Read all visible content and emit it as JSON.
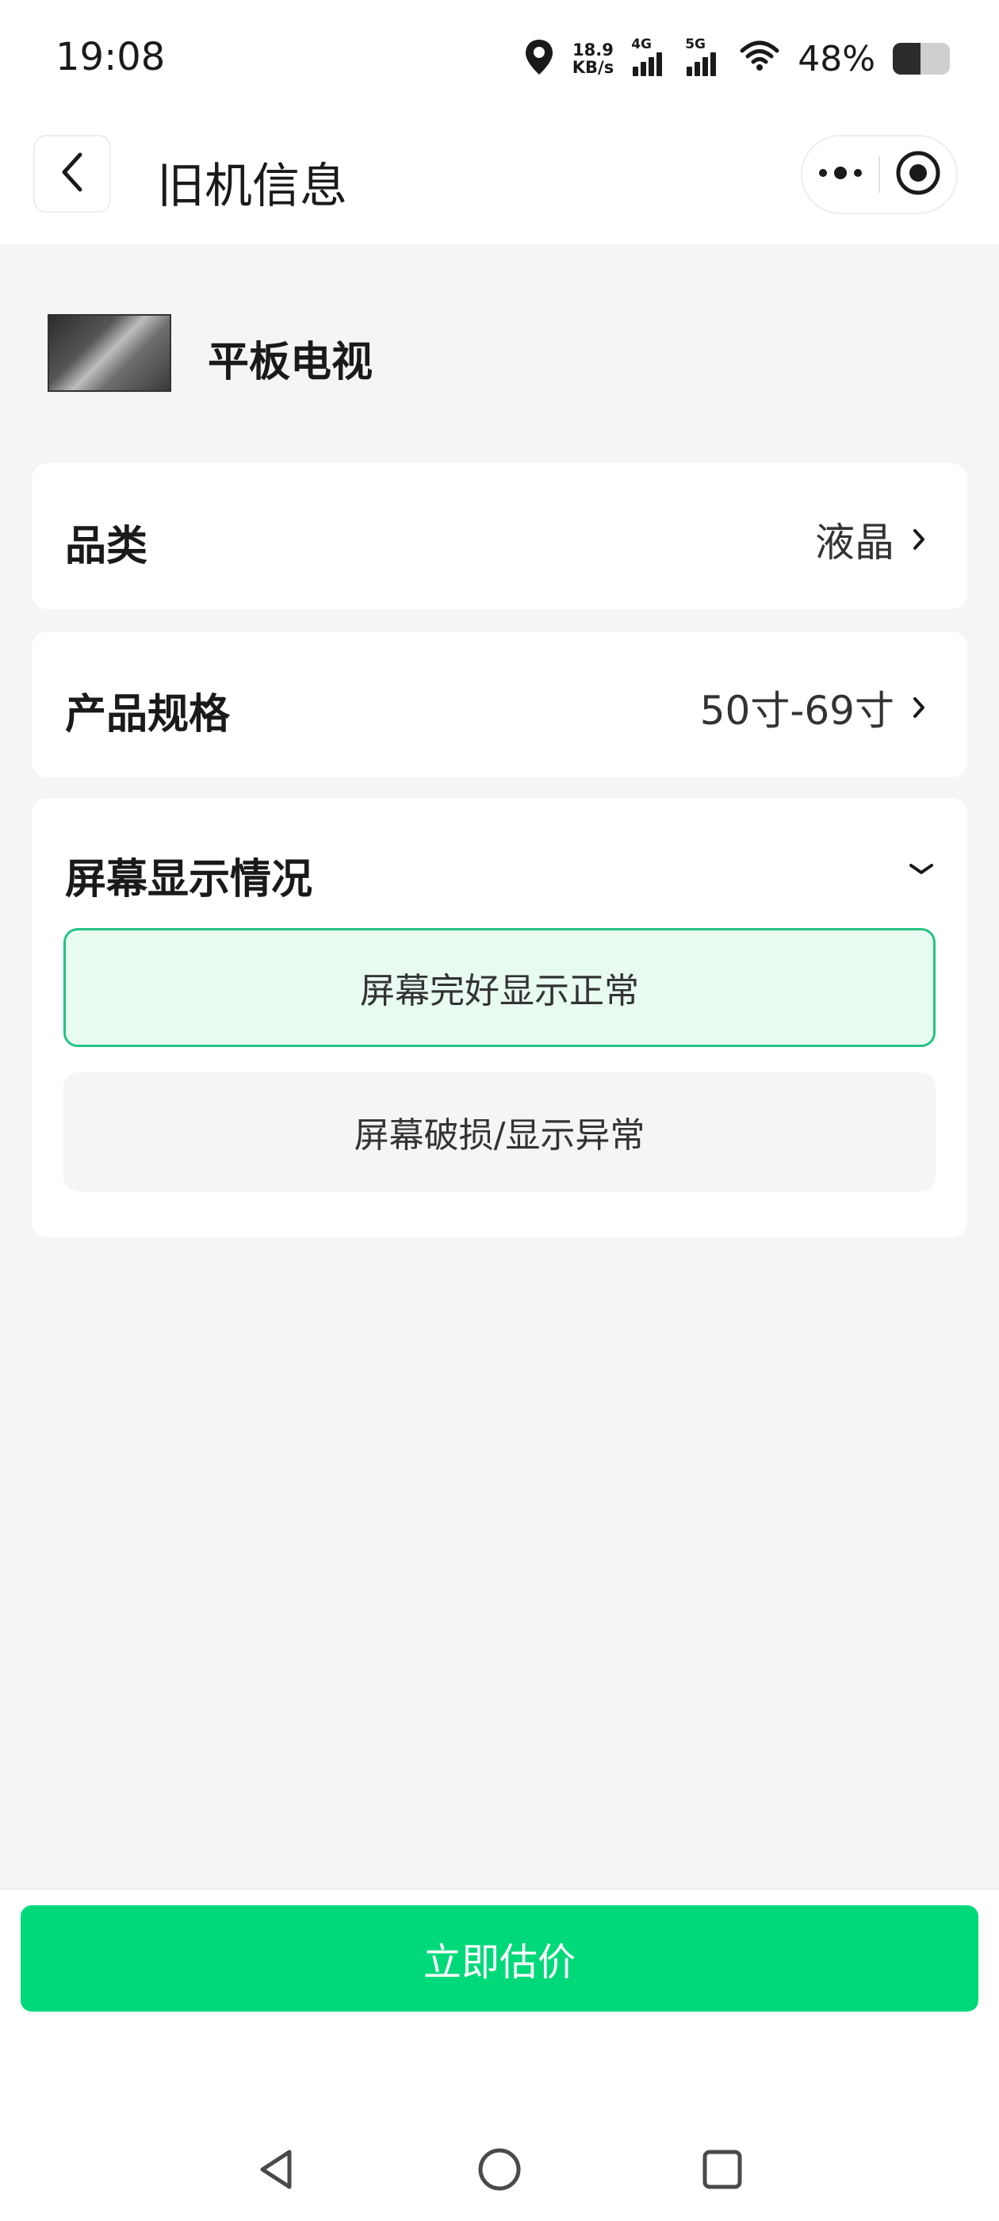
{
  "status_bar": {
    "time": "19:08",
    "speed_value": "18.9",
    "speed_unit": "KB/s",
    "network_1": "4G",
    "network_2": "5G",
    "battery_percent": "48%",
    "battery_level": 0.48,
    "icons": [
      "location-icon",
      "signal-icon",
      "wifi-icon",
      "battery-icon"
    ]
  },
  "nav": {
    "title": "旧机信息",
    "back_icon": "chevron-left-icon",
    "more_icon": "more-dots-icon",
    "close_icon": "target-circle-icon"
  },
  "product": {
    "name": "平板电视"
  },
  "fields": [
    {
      "label": "品类",
      "value": "液晶"
    },
    {
      "label": "产品规格",
      "value": "50寸-69寸"
    }
  ],
  "screen_section": {
    "label": "屏幕显示情况",
    "options": [
      {
        "label": "屏幕完好显示正常",
        "selected": true
      },
      {
        "label": "屏幕破损/显示异常",
        "selected": false
      }
    ]
  },
  "footer": {
    "cta_label": "立即估价"
  },
  "colors": {
    "accent": "#00d97a",
    "selected_border": "#25c383",
    "selected_bg": "#e8fbf1",
    "page_bg": "#f5f5f5"
  }
}
